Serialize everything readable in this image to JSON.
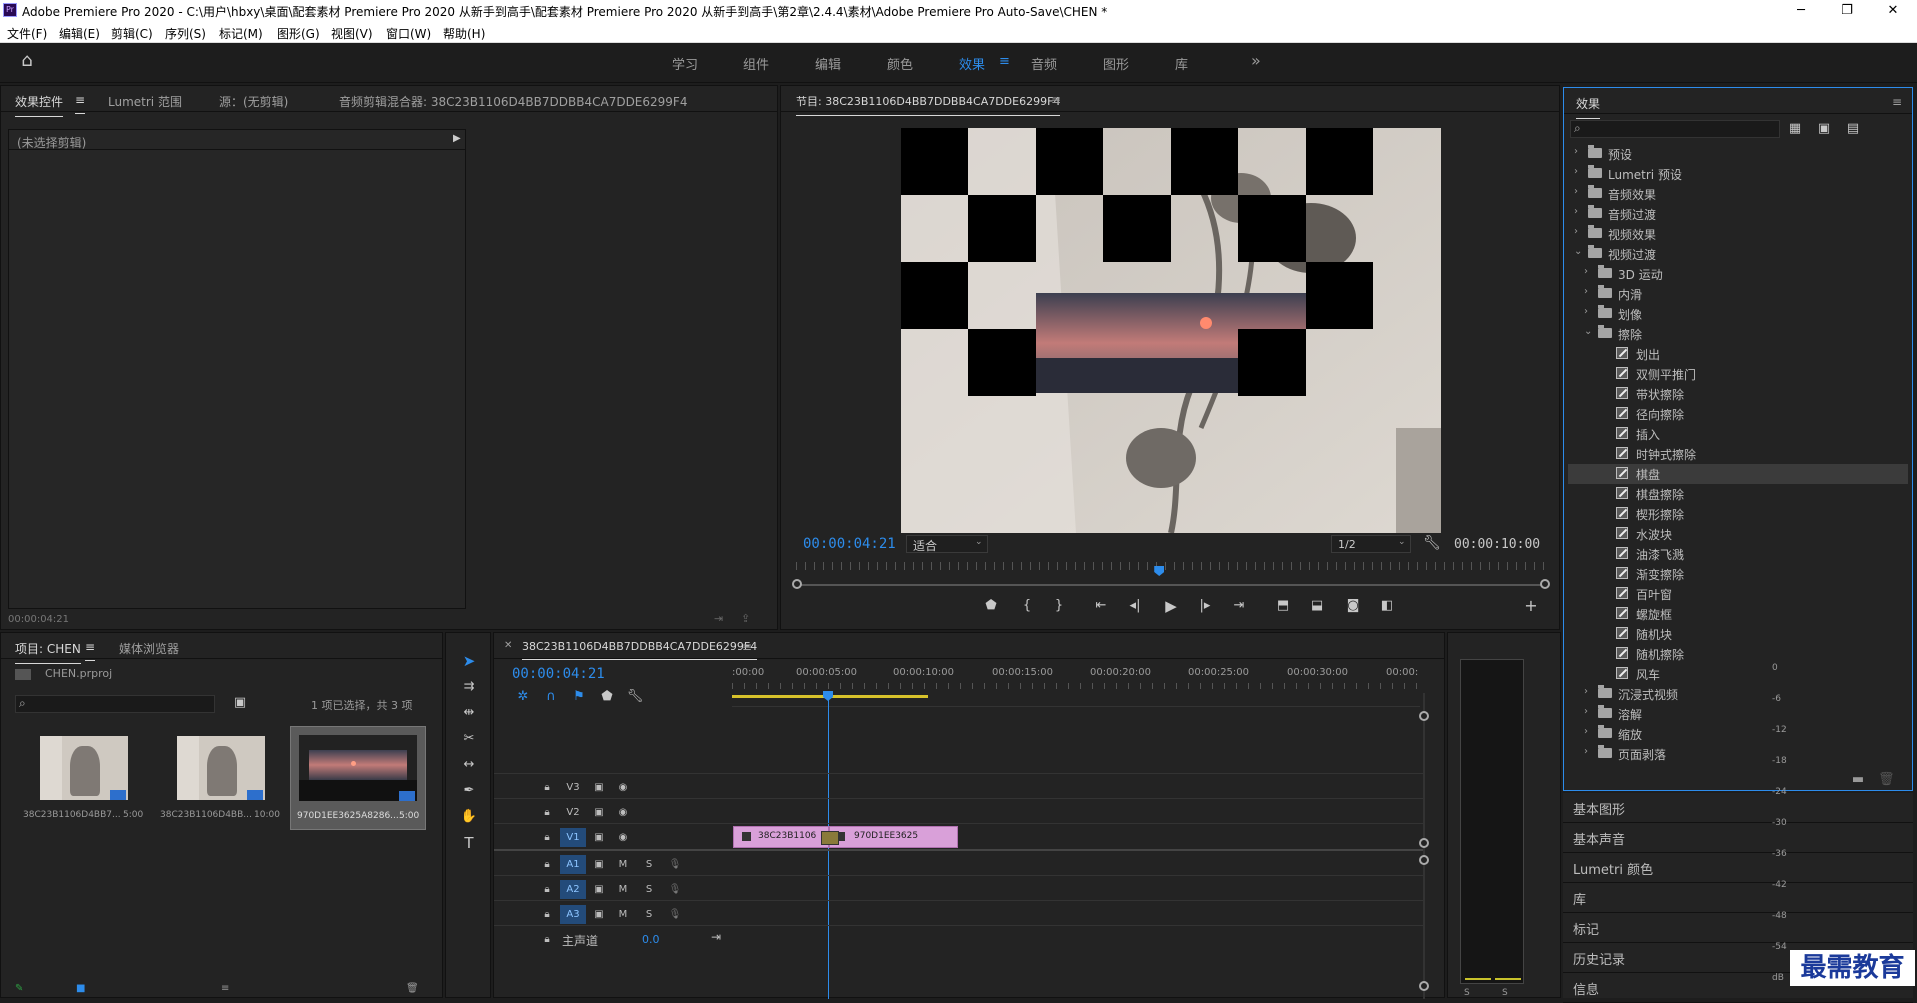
{
  "window": {
    "title": "Adobe Premiere Pro 2020 - C:\\用户\\hbxy\\桌面\\配套素材 Premiere Pro 2020 从新手到高手\\配套素材 Premiere Pro 2020 从新手到高手\\第2章\\2.4.4\\素材\\Adobe Premiere Pro Auto-Save\\CHEN *",
    "app_icon": "Pr",
    "minimize": "─",
    "restore": "❐",
    "close": "✕"
  },
  "menu": [
    "文件(F)",
    "编辑(E)",
    "剪辑(C)",
    "序列(S)",
    "标记(M)",
    "图形(G)",
    "视图(V)",
    "窗口(W)",
    "帮助(H)"
  ],
  "workspaces": {
    "items": [
      "学习",
      "组件",
      "编辑",
      "颜色",
      "效果",
      "音频",
      "图形",
      "库"
    ],
    "active": "效果",
    "more": "»"
  },
  "effect_controls": {
    "tabs": [
      "效果控件",
      "Lumetri 范围",
      "源：(无剪辑)",
      "音频剪辑混合器: 38C23B1106D4BB7DDBB4CA7DDE6299F4"
    ],
    "no_clip": "(未选择剪辑)",
    "timecode": "00:00:04:21"
  },
  "program": {
    "title": "节目: 38C23B1106D4BB7DDBB4CA7DDE6299F4",
    "timecode": "00:00:04:21",
    "fit": "适合",
    "quality": "1/2",
    "duration": "00:00:10:00",
    "playhead_fraction": 0.4843
  },
  "effects": {
    "title": "效果",
    "search_placeholder": "",
    "tree": [
      {
        "label": "预设",
        "level": 0,
        "kind": "folder",
        "expanded": false
      },
      {
        "label": "Lumetri 预设",
        "level": 0,
        "kind": "folder",
        "expanded": false
      },
      {
        "label": "音频效果",
        "level": 0,
        "kind": "folder",
        "expanded": false
      },
      {
        "label": "音频过渡",
        "level": 0,
        "kind": "folder",
        "expanded": false
      },
      {
        "label": "视频效果",
        "level": 0,
        "kind": "folder",
        "expanded": false
      },
      {
        "label": "视频过渡",
        "level": 0,
        "kind": "folder",
        "expanded": true
      },
      {
        "label": "3D 运动",
        "level": 1,
        "kind": "folder",
        "expanded": false
      },
      {
        "label": "内滑",
        "level": 1,
        "kind": "folder",
        "expanded": false
      },
      {
        "label": "划像",
        "level": 1,
        "kind": "folder",
        "expanded": false
      },
      {
        "label": "擦除",
        "level": 1,
        "kind": "folder",
        "expanded": true
      },
      {
        "label": "划出",
        "level": 2,
        "kind": "fx"
      },
      {
        "label": "双侧平推门",
        "level": 2,
        "kind": "fx"
      },
      {
        "label": "带状擦除",
        "level": 2,
        "kind": "fx"
      },
      {
        "label": "径向擦除",
        "level": 2,
        "kind": "fx"
      },
      {
        "label": "插入",
        "level": 2,
        "kind": "fx"
      },
      {
        "label": "时钟式擦除",
        "level": 2,
        "kind": "fx"
      },
      {
        "label": "棋盘",
        "level": 2,
        "kind": "fx",
        "selected": true
      },
      {
        "label": "棋盘擦除",
        "level": 2,
        "kind": "fx"
      },
      {
        "label": "楔形擦除",
        "level": 2,
        "kind": "fx"
      },
      {
        "label": "水波块",
        "level": 2,
        "kind": "fx"
      },
      {
        "label": "油漆飞溅",
        "level": 2,
        "kind": "fx"
      },
      {
        "label": "渐变擦除",
        "level": 2,
        "kind": "fx"
      },
      {
        "label": "百叶窗",
        "level": 2,
        "kind": "fx"
      },
      {
        "label": "螺旋框",
        "level": 2,
        "kind": "fx"
      },
      {
        "label": "随机块",
        "level": 2,
        "kind": "fx"
      },
      {
        "label": "随机擦除",
        "level": 2,
        "kind": "fx"
      },
      {
        "label": "风车",
        "level": 2,
        "kind": "fx"
      },
      {
        "label": "沉浸式视频",
        "level": 1,
        "kind": "folder",
        "expanded": false
      },
      {
        "label": "溶解",
        "level": 1,
        "kind": "folder",
        "expanded": false
      },
      {
        "label": "缩放",
        "level": 1,
        "kind": "folder",
        "expanded": false
      },
      {
        "label": "页面剥落",
        "level": 1,
        "kind": "folder",
        "expanded": false
      }
    ]
  },
  "side_panels": [
    "基本图形",
    "基本声音",
    "Lumetri 颜色",
    "库",
    "标记",
    "历史记录",
    "信息"
  ],
  "project": {
    "tabs": [
      "项目: CHEN",
      "媒体浏览器"
    ],
    "file": "CHEN.prproj",
    "selection": "1 项已选择，共 3 项",
    "items": [
      {
        "name": "38C23B1106D4BB7...",
        "dur": "5:00"
      },
      {
        "name": "38C23B1106D4BB...",
        "dur": "10:00"
      },
      {
        "name": "970D1EE3625A8286...",
        "dur": "5:00"
      }
    ]
  },
  "timeline": {
    "tab": "38C23B1106D4BB7DDBB4CA7DDE6299F4",
    "timecode": "00:00:04:21",
    "ruler": [
      ":00:00",
      "00:00:05:00",
      "00:00:10:00",
      "00:00:15:00",
      "00:00:20:00",
      "00:00:25:00",
      "00:00:30:00",
      "00:00:"
    ],
    "video_tracks": [
      "V3",
      "V2",
      "V1"
    ],
    "audio_tracks": [
      "A1",
      "A2",
      "A3"
    ],
    "master": "主声道",
    "master_val": "0.0",
    "clips": [
      {
        "label": "38C23B1106"
      },
      {
        "label": "970D1EE3625"
      }
    ],
    "m": "M",
    "s": "S"
  },
  "meter": {
    "labels": [
      "0",
      "-6",
      "-12",
      "-18",
      "-24",
      "-30",
      "-36",
      "-42",
      "-48",
      "-54",
      "dB"
    ],
    "bottom": [
      "S",
      "S"
    ]
  },
  "watermark": "最需教育"
}
